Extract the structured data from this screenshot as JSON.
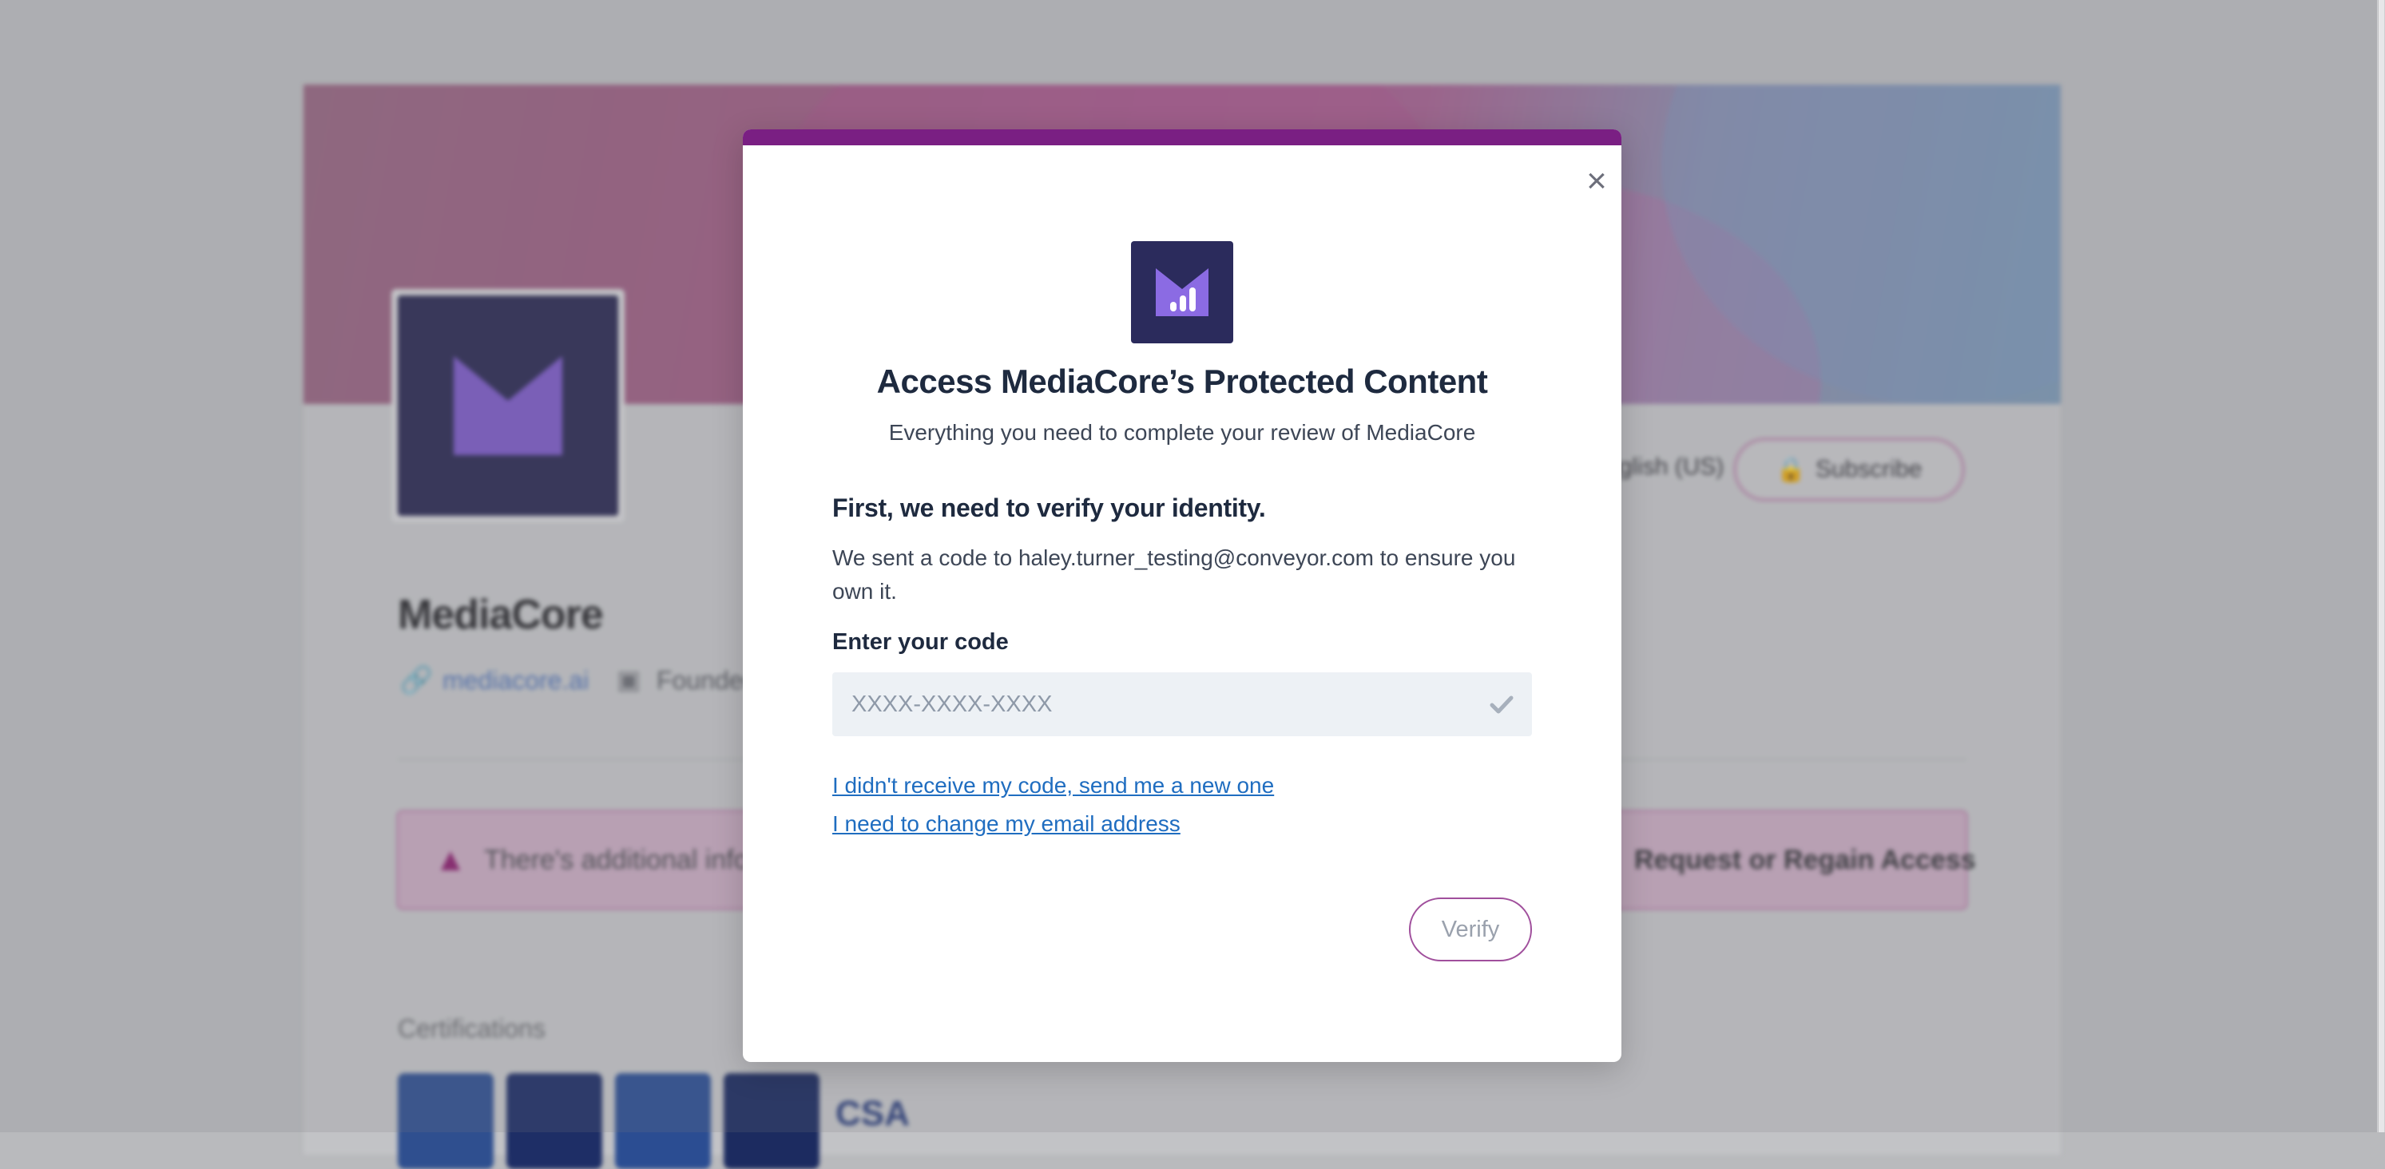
{
  "background": {
    "company_name": "MediaCore",
    "website_link": "mediacore.ai",
    "founded_label": "Founded",
    "notice_text": "There's additional inform",
    "notice_button": "Request or Regain Access",
    "subscribe_label": "Subscribe",
    "language_label": "English (US)",
    "certifications_label": "Certifications",
    "cert_badge_text": "CSA"
  },
  "modal": {
    "title": "Access MediaCore’s Protected Content",
    "subtitle": "Everything you need to complete your review of MediaCore",
    "verify_heading": "First, we need to verify your identity.",
    "verify_text": "We sent a code to haley.turner_testing@conveyor.com to ensure you own it.",
    "code_label": "Enter your code",
    "code_value": "",
    "code_placeholder": "XXXX-XXXX-XXXX",
    "resend_link": "I didn't receive my code, send me a new one",
    "change_email_link": "I need to change my email address",
    "verify_button": "Verify",
    "close_symbol": "×"
  },
  "colors": {
    "accent_bar": "#7a1f83",
    "link": "#1f6dc0",
    "logo_bg": "#2b2b5c",
    "logo_mark": "#8b6be3"
  },
  "icons": {
    "close": "close-icon",
    "logo": "mediacore-logo-icon",
    "check": "check-icon",
    "link": "link-icon",
    "building": "building-icon",
    "lock": "lock-icon",
    "warning": "warning-icon"
  }
}
